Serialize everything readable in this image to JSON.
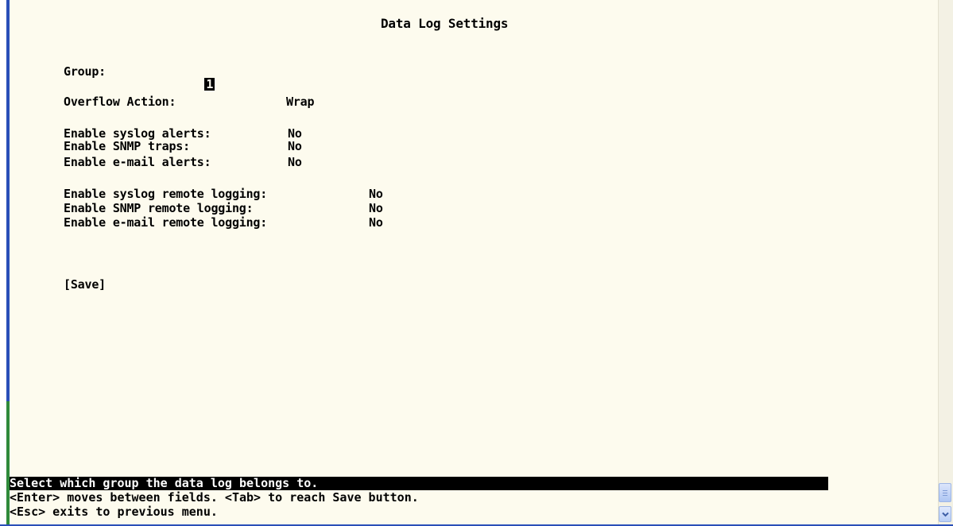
{
  "screen": {
    "title": "Data Log Settings"
  },
  "form": {
    "group_label": "Group:",
    "group_value": "1",
    "overflow_label": "Overflow Action:",
    "overflow_value": "Wrap",
    "syslog_alerts_label": "Enable syslog alerts:",
    "syslog_alerts_value": "No",
    "snmp_traps_label": "Enable SNMP traps:",
    "snmp_traps_value": "No",
    "email_alerts_label": "Enable e-mail alerts:",
    "email_alerts_value": "No",
    "syslog_remote_label": "Enable syslog remote logging:",
    "syslog_remote_value": "No",
    "snmp_remote_label": "Enable SNMP remote logging:",
    "snmp_remote_value": "No",
    "email_remote_label": "Enable e-mail remote logging:",
    "email_remote_value": "No",
    "save_label": "[Save]"
  },
  "status": {
    "help_line": "Select which group the data log belongs to.",
    "nav_line_1": "<Enter> moves between fields. <Tab> to reach Save button.",
    "nav_line_2": "<Esc> exits to previous menu."
  },
  "icons": {
    "scroll_down": "chevron-down-icon",
    "scroll_thumb": "scroll-thumb"
  }
}
